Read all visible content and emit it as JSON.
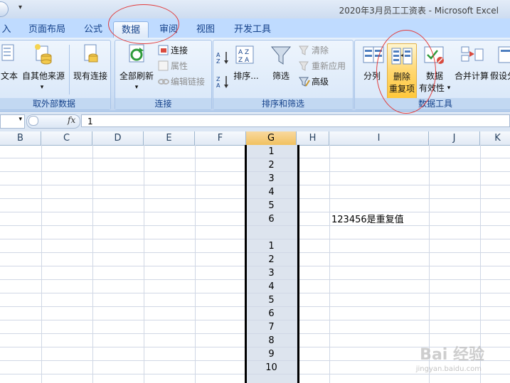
{
  "window": {
    "title": "2020年3月员工工资表 - Microsoft Excel"
  },
  "tabs": [
    {
      "label": "入"
    },
    {
      "label": "页面布局"
    },
    {
      "label": "公式"
    },
    {
      "label": "数据",
      "active": true
    },
    {
      "label": "审阅"
    },
    {
      "label": "视图"
    },
    {
      "label": "开发工具"
    }
  ],
  "ribbon": {
    "external": {
      "label": "取外部数据",
      "text_btn": "文本",
      "other_btn": "自其他来源",
      "existing_btn": "现有连接"
    },
    "connections": {
      "label": "连接",
      "refresh_all": "全部刷新",
      "connections": "连接",
      "properties": "属性",
      "edit_links": "编辑链接"
    },
    "sort_filter": {
      "label": "排序和筛选",
      "sort": "排序...",
      "filter": "筛选",
      "clear": "清除",
      "reapply": "重新应用",
      "advanced": "高级"
    },
    "data_tools": {
      "label": "数据工具",
      "split": "分列",
      "remove_dup_1": "删除",
      "remove_dup_2": "重复项",
      "validation_1": "数据",
      "validation_2": "有效性",
      "consolidate": "合并计算",
      "whatif": "假设分"
    }
  },
  "formula_bar": {
    "fx": "fx",
    "value": "1"
  },
  "columns": [
    "B",
    "C",
    "D",
    "E",
    "F",
    "G",
    "H",
    "I",
    "J",
    "K"
  ],
  "selected_column": "G",
  "cells_g": [
    "1",
    "2",
    "3",
    "4",
    "5",
    "6",
    "",
    "1",
    "2",
    "3",
    "4",
    "5",
    "6",
    "7",
    "8",
    "9",
    "10"
  ],
  "note_cell": "123456是重复值",
  "watermark": {
    "main": "Bai 经验",
    "sub": "jingyan.baidu.com"
  },
  "colors": {
    "annotation": "#e23c3c",
    "selection_highlight": "#ffc83a"
  }
}
